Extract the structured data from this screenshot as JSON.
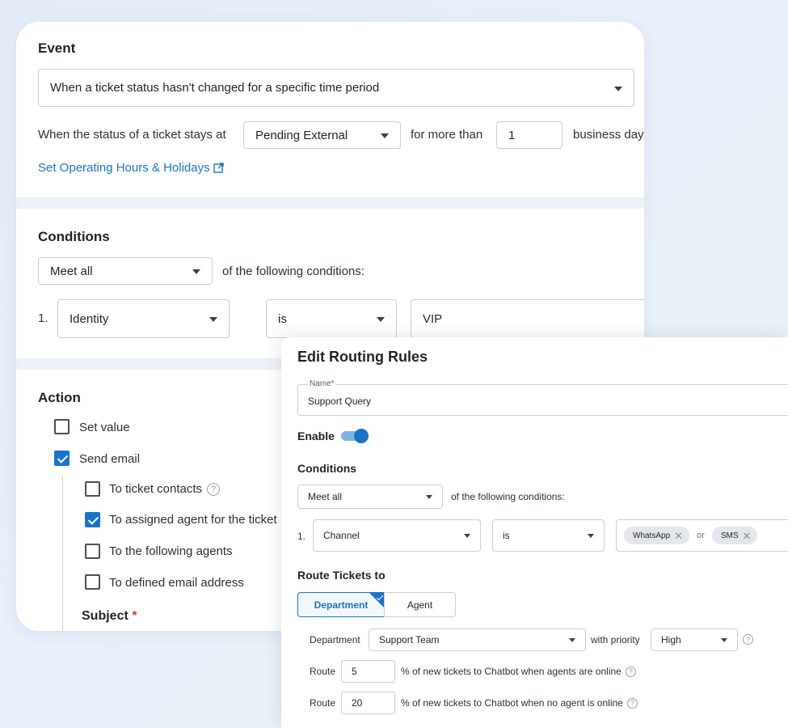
{
  "event": {
    "title": "Event",
    "trigger_select": "When a ticket status hasn't changed for a specific time period",
    "status_prefix": "When the status of a ticket stays at",
    "status_select": "Pending External",
    "duration_prefix": "for more than",
    "duration_value": "1",
    "duration_unit": "business day",
    "operating_hours_link": "Set Operating Hours & Holidays",
    "link_icon": "external-link-icon"
  },
  "conditions": {
    "title": "Conditions",
    "match_select": "Meet all",
    "match_suffix": "of the following conditions:",
    "rows": [
      {
        "index": "1.",
        "field": "Identity",
        "operator": "is",
        "value": "VIP"
      }
    ]
  },
  "action": {
    "title": "Action",
    "items": [
      {
        "label": "Set value",
        "checked": false
      },
      {
        "label": "Send email",
        "checked": true
      }
    ],
    "email_targets": [
      {
        "label": "To ticket contacts",
        "checked": false,
        "help": "?"
      },
      {
        "label": "To assigned agent for the ticket",
        "checked": true
      },
      {
        "label": "To the following agents",
        "checked": false
      },
      {
        "label": "To defined email address",
        "checked": false
      }
    ],
    "subject_label": "Subject",
    "required_mark": "*"
  },
  "routing": {
    "title": "Edit Routing Rules",
    "name_label": "Name",
    "name_required": "*",
    "name_value": "Support Query",
    "enable_label": "Enable",
    "enabled": true,
    "conditions_label": "Conditions",
    "match_select": "Meet all",
    "match_suffix": "of the following conditions:",
    "condition": {
      "index": "1.",
      "field": "Channel",
      "operator": "is",
      "values": [
        "WhatsApp",
        "SMS"
      ],
      "joiner": "or"
    },
    "route_label": "Route Tickets to",
    "tabs": [
      {
        "label": "Department",
        "active": true
      },
      {
        "label": "Agent",
        "active": false
      }
    ],
    "department_label": "Department",
    "department_value": "Support Team",
    "priority_label": "with priority",
    "priority_value": "High",
    "route_word": "Route",
    "online_percent": "5",
    "online_text": "% of new tickets to Chatbot when agents are online",
    "offline_percent": "20",
    "offline_text": "% of new tickets to Chatbot when no agent is online",
    "help": "?"
  },
  "colors": {
    "accent": "#1a73c9",
    "required": "#e0362c"
  }
}
